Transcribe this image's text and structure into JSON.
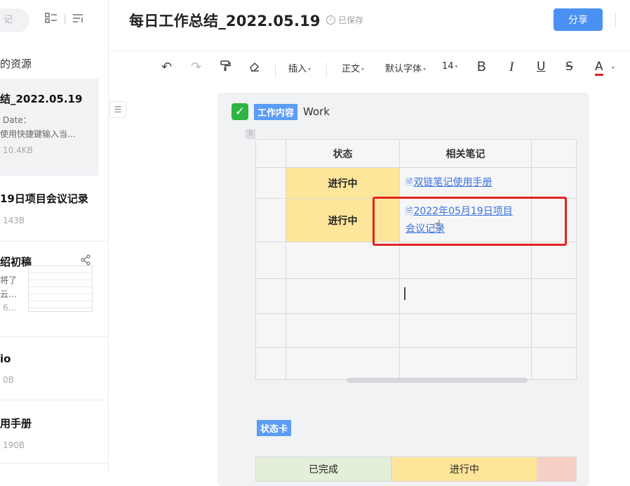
{
  "sidebar": {
    "search_placeholder": "记",
    "section_title": "的资源",
    "items": [
      {
        "title": "结_2022.05.19",
        "lines": [
          "Date：",
          "使用快捷键输入当…"
        ],
        "size": "10.4KB"
      },
      {
        "title": "19日项目会议记录",
        "lines": [],
        "size": "143B"
      },
      {
        "title": "绍初稿",
        "lines": [
          "将了",
          "云…"
        ],
        "size": "6…"
      },
      {
        "title": "io",
        "lines": [],
        "size": "0B"
      },
      {
        "title": "用手册",
        "lines": [],
        "size": "190B"
      }
    ]
  },
  "header": {
    "title": "每日工作总结_2022.05.19",
    "saved_label": "已保存",
    "share_label": "分享"
  },
  "toolbar": {
    "insert_label": "插入",
    "style_label": "正文",
    "font_label": "默认字体",
    "size_label": "14",
    "bold": "B",
    "italic": "I",
    "underline": "U",
    "strike": "S",
    "color": "A"
  },
  "document": {
    "block_tag": "工作内容",
    "block_text": "Work",
    "table": {
      "headers": [
        "",
        "状态",
        "相关笔记",
        ""
      ],
      "rows": [
        {
          "status": "进行中",
          "note_line1": "双链笔记使用手册",
          "note_line2": ""
        },
        {
          "status": "进行中",
          "note_line1": "2022年05月19日项目",
          "note_line2": "会议记录"
        }
      ]
    },
    "status_card_tag": "状态卡",
    "status_card_cols": [
      "已完成",
      "进行中"
    ]
  },
  "colors": {
    "accent": "#4a90f5",
    "tag_blue": "#5b9cf6",
    "yellow_cell": "#fde59a",
    "highlight_red": "#e32222",
    "green_check": "#2fb344"
  }
}
